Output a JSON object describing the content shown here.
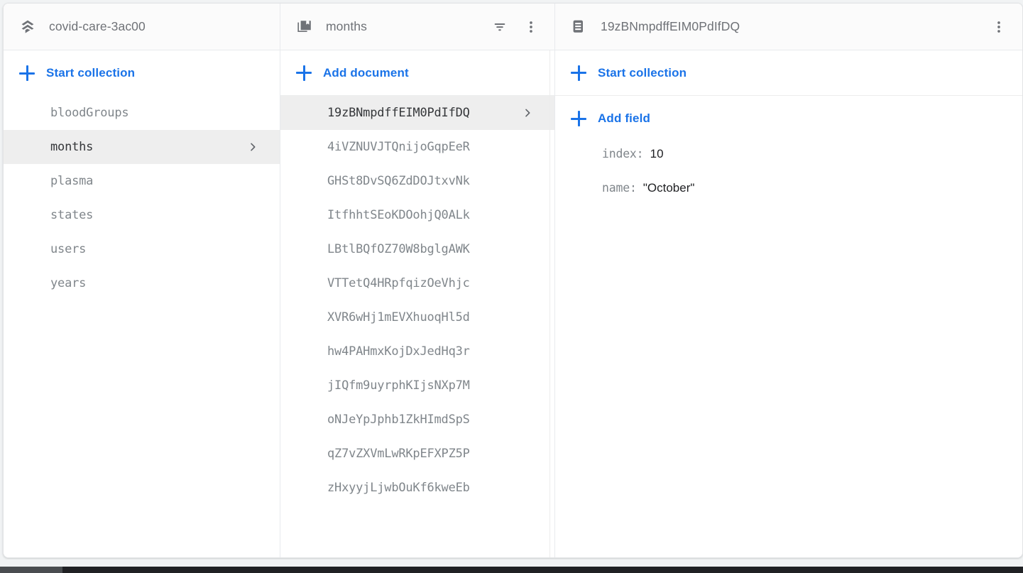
{
  "collections_panel": {
    "header": {
      "icon": "firestore-stack-icon",
      "title": "covid-care-3ac00"
    },
    "action": {
      "icon": "plus-icon",
      "label": "Start collection"
    },
    "items": [
      {
        "label": "bloodGroups",
        "selected": false
      },
      {
        "label": "months",
        "selected": true
      },
      {
        "label": "plasma",
        "selected": false
      },
      {
        "label": "states",
        "selected": false
      },
      {
        "label": "users",
        "selected": false
      },
      {
        "label": "years",
        "selected": false
      }
    ]
  },
  "documents_panel": {
    "header": {
      "icon": "collection-icon",
      "title": "months",
      "filter_icon": "filter-icon",
      "menu_icon": "more-vert-icon"
    },
    "action": {
      "icon": "plus-icon",
      "label": "Add document"
    },
    "items": [
      {
        "label": "19zBNmpdffEIM0PdIfDQ",
        "selected": true
      },
      {
        "label": "4iVZNUVJTQnijoGqpEeR",
        "selected": false
      },
      {
        "label": "GHSt8DvSQ6ZdDOJtxvNk",
        "selected": false
      },
      {
        "label": "ItfhhtSEoKDOohjQ0ALk",
        "selected": false
      },
      {
        "label": "LBtlBQfOZ70W8bglgAWK",
        "selected": false
      },
      {
        "label": "VTTetQ4HRpfqizOeVhjc",
        "selected": false
      },
      {
        "label": "XVR6wHj1mEVXhuoqHl5d",
        "selected": false
      },
      {
        "label": "hw4PAHmxKojDxJedHq3r",
        "selected": false
      },
      {
        "label": "jIQfm9uyrphKIjsNXp7M",
        "selected": false
      },
      {
        "label": "oNJeYpJphb1ZkHImdSpS",
        "selected": false
      },
      {
        "label": "qZ7vZXVmLwRKpEFXPZ5P",
        "selected": false
      },
      {
        "label": "zHxyyjLjwbOuKf6kweEb",
        "selected": false
      }
    ]
  },
  "fields_panel": {
    "header": {
      "icon": "document-icon",
      "title": "19zBNmpdffEIM0PdIfDQ",
      "menu_icon": "more-vert-icon"
    },
    "start_collection": {
      "icon": "plus-icon",
      "label": "Start collection"
    },
    "add_field": {
      "icon": "plus-icon",
      "label": "Add field"
    },
    "fields": [
      {
        "key": "index",
        "separator": ":",
        "value": "10"
      },
      {
        "key": "name",
        "separator": ":",
        "value": "\"October\""
      }
    ]
  },
  "colors": {
    "accent": "#1a73e8",
    "selected_row_bg": "#eeeeee",
    "muted_text": "#80868b",
    "header_text": "#6f7277",
    "value_text": "#202124",
    "page_bg": "#f1f3f4",
    "scrollbar_track": "#202124",
    "scrollbar_thumb": "#4a4d50"
  }
}
